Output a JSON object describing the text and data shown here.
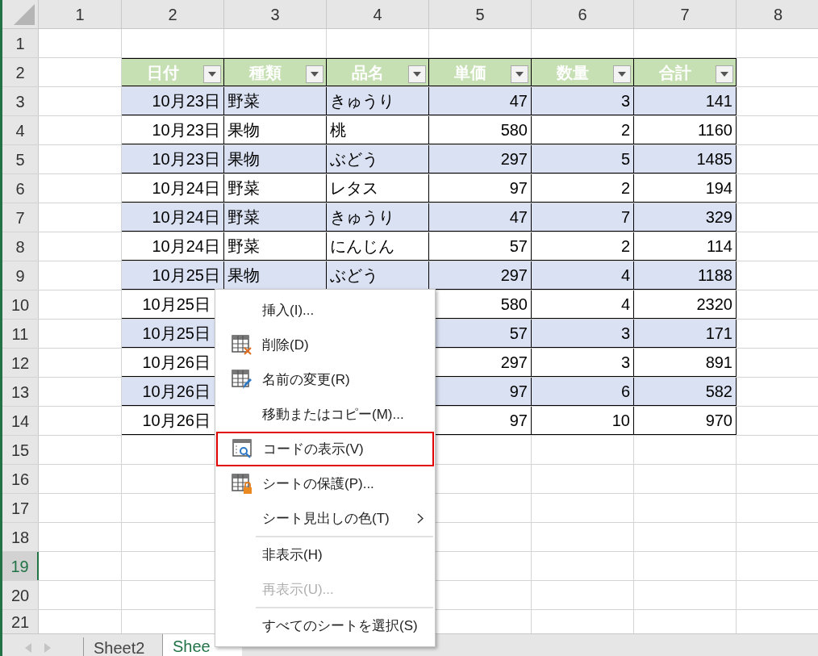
{
  "column_headers": [
    "1",
    "2",
    "3",
    "4",
    "5",
    "6",
    "7",
    "8"
  ],
  "row_headers": [
    {
      "label": "1",
      "selected": false
    },
    {
      "label": "2",
      "selected": false
    },
    {
      "label": "3",
      "selected": false
    },
    {
      "label": "4",
      "selected": false
    },
    {
      "label": "5",
      "selected": false
    },
    {
      "label": "6",
      "selected": false
    },
    {
      "label": "7",
      "selected": false
    },
    {
      "label": "8",
      "selected": false
    },
    {
      "label": "9",
      "selected": false
    },
    {
      "label": "10",
      "selected": false
    },
    {
      "label": "11",
      "selected": false
    },
    {
      "label": "12",
      "selected": false
    },
    {
      "label": "13",
      "selected": false
    },
    {
      "label": "14",
      "selected": false
    },
    {
      "label": "15",
      "selected": false
    },
    {
      "label": "16",
      "selected": false
    },
    {
      "label": "17",
      "selected": false
    },
    {
      "label": "18",
      "selected": false
    },
    {
      "label": "19",
      "selected": true
    },
    {
      "label": "20",
      "selected": false
    },
    {
      "label": "21",
      "selected": false
    }
  ],
  "table": {
    "columns": [
      "日付",
      "種類",
      "品名",
      "単価",
      "数量",
      "合計"
    ],
    "rows": [
      {
        "date": "10月23日",
        "category": "野菜",
        "item": "きゅうり",
        "unit_price": "47",
        "quantity": "3",
        "total": "141"
      },
      {
        "date": "10月23日",
        "category": "果物",
        "item": "桃",
        "unit_price": "580",
        "quantity": "2",
        "total": "1160"
      },
      {
        "date": "10月23日",
        "category": "果物",
        "item": "ぶどう",
        "unit_price": "297",
        "quantity": "5",
        "total": "1485"
      },
      {
        "date": "10月24日",
        "category": "野菜",
        "item": "レタス",
        "unit_price": "97",
        "quantity": "2",
        "total": "194"
      },
      {
        "date": "10月24日",
        "category": "野菜",
        "item": "きゅうり",
        "unit_price": "47",
        "quantity": "7",
        "total": "329"
      },
      {
        "date": "10月24日",
        "category": "野菜",
        "item": "にんじん",
        "unit_price": "57",
        "quantity": "2",
        "total": "114"
      },
      {
        "date": "10月25日",
        "category": "果物",
        "item": "ぶどう",
        "unit_price": "297",
        "quantity": "4",
        "total": "1188"
      },
      {
        "date": "10月25日",
        "unit_price": "580",
        "quantity": "4",
        "total": "2320"
      },
      {
        "date": "10月25日",
        "unit_price": "57",
        "quantity": "3",
        "total": "171"
      },
      {
        "date": "10月26日",
        "unit_price": "297",
        "quantity": "3",
        "total": "891"
      },
      {
        "date": "10月26日",
        "unit_price": "97",
        "quantity": "6",
        "total": "582"
      },
      {
        "date": "10月26日",
        "unit_price": "97",
        "quantity": "10",
        "total": "970"
      }
    ]
  },
  "context_menu": [
    {
      "kind": "plain",
      "label": "挿入(I)...",
      "selected": false,
      "disabled": false
    },
    {
      "kind": "delete",
      "label": "削除(D)",
      "selected": false,
      "disabled": false
    },
    {
      "kind": "rename",
      "label": "名前の変更(R)",
      "selected": false,
      "disabled": false
    },
    {
      "kind": "plain",
      "label": "移動またはコピー(M)...",
      "selected": false,
      "disabled": false
    },
    {
      "kind": "code",
      "label": "コードの表示(V)",
      "selected": true,
      "disabled": false
    },
    {
      "kind": "protect",
      "label": "シートの保護(P)...",
      "selected": false,
      "disabled": false
    },
    {
      "kind": "submenu",
      "label": "シート見出しの色(T)",
      "selected": false,
      "disabled": false
    },
    {
      "kind": "separator"
    },
    {
      "kind": "plain",
      "label": "非表示(H)",
      "selected": false,
      "disabled": false
    },
    {
      "kind": "plain",
      "label": "再表示(U)...",
      "selected": false,
      "disabled": true
    },
    {
      "kind": "separator"
    },
    {
      "kind": "plain",
      "label": "すべてのシートを選択(S)",
      "selected": false,
      "disabled": false
    }
  ],
  "sheet_tabs": [
    {
      "label": "Sheet2",
      "selected": false
    },
    {
      "label": "Shee",
      "selected": true
    }
  ]
}
